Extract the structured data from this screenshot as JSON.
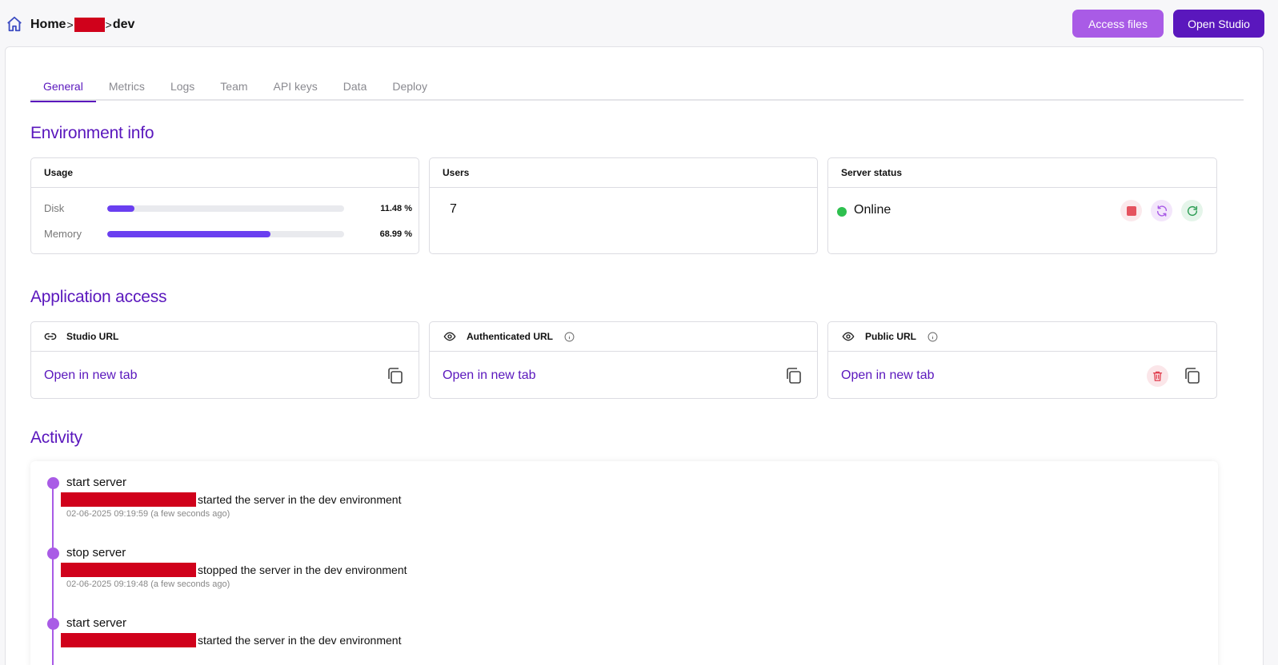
{
  "breadcrumb": {
    "home": "Home",
    "sep1": ">",
    "sep2": ">",
    "current": "dev"
  },
  "header": {
    "access_files": "Access files",
    "open_studio": "Open Studio"
  },
  "tabs": [
    {
      "label": "General",
      "active": true
    },
    {
      "label": "Metrics"
    },
    {
      "label": "Logs"
    },
    {
      "label": "Team"
    },
    {
      "label": "API keys"
    },
    {
      "label": "Data"
    },
    {
      "label": "Deploy"
    }
  ],
  "env_info": {
    "title": "Environment info",
    "usage": {
      "title": "Usage",
      "disk": {
        "label": "Disk",
        "value": "11.48 %",
        "fraction": 0.1148
      },
      "memory": {
        "label": "Memory",
        "value": "68.99 %",
        "fraction": 0.6899
      }
    },
    "users": {
      "title": "Users",
      "count": "7"
    },
    "server": {
      "title": "Server status",
      "status": "Online"
    }
  },
  "app_access": {
    "title": "Application access",
    "studio": {
      "title": "Studio URL",
      "link": "Open in new tab"
    },
    "authenticated": {
      "title": "Authenticated URL",
      "link": "Open in new tab"
    },
    "public": {
      "title": "Public URL",
      "link": "Open in new tab"
    }
  },
  "activity": {
    "title": "Activity",
    "items": [
      {
        "title": "start server",
        "desc": "started the server in the dev environment",
        "time": "02-06-2025 09:19:59 (a few seconds ago)"
      },
      {
        "title": "stop server",
        "desc": "stopped the server in the dev environment",
        "time": "02-06-2025 09:19:48 (a few seconds ago)"
      },
      {
        "title": "start server",
        "desc": "started the server in the dev environment",
        "time": ""
      }
    ]
  },
  "colors": {
    "accent": "#5a17bd",
    "accent_light": "#a95be6",
    "online": "#2ec04f",
    "redacted": "#d0011b"
  }
}
